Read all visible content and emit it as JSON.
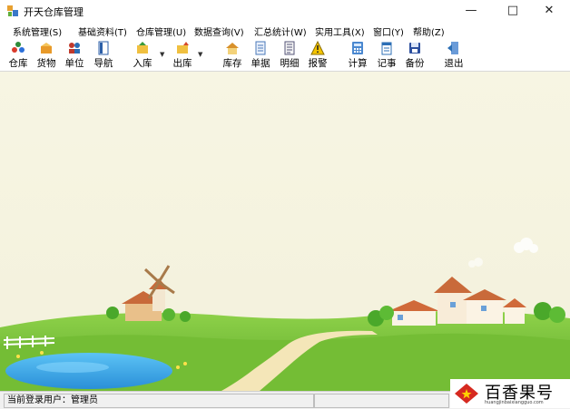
{
  "window": {
    "title": "开天仓库管理"
  },
  "menu": [
    "系统管理(S)",
    "基础资料(T)",
    "仓库管理(U)",
    "数据查询(V)",
    "汇总统计(W)",
    "实用工具(X)",
    "窗口(Y)",
    "帮助(Z)"
  ],
  "toolbar": [
    {
      "label": "仓库",
      "icon": "warehouse-users-icon"
    },
    {
      "label": "货物",
      "icon": "goods-box-icon"
    },
    {
      "label": "单位",
      "icon": "units-people-icon"
    },
    {
      "label": "导航",
      "icon": "navigation-panel-icon"
    },
    {
      "label": "入库",
      "icon": "stock-in-icon"
    },
    {
      "label": "出库",
      "icon": "stock-out-icon"
    },
    {
      "label": "库存",
      "icon": "inventory-house-icon"
    },
    {
      "label": "单据",
      "icon": "document-list-icon"
    },
    {
      "label": "明细",
      "icon": "detail-list-icon"
    },
    {
      "label": "报警",
      "icon": "warning-icon"
    },
    {
      "label": "计算",
      "icon": "calculator-icon"
    },
    {
      "label": "记事",
      "icon": "notepad-icon"
    },
    {
      "label": "备份",
      "icon": "backup-disk-icon"
    },
    {
      "label": "退出",
      "icon": "exit-door-icon"
    }
  ],
  "status": {
    "user_label": "当前登录用户：管理员"
  },
  "watermark": {
    "brand": "百香果号",
    "url": "huangjinbaixiangguo.com"
  },
  "colors": {
    "sky": "#f7f5e6",
    "grass": "#7cc23a",
    "pond": "#3aa8e8",
    "path": "#f3e4b5"
  }
}
